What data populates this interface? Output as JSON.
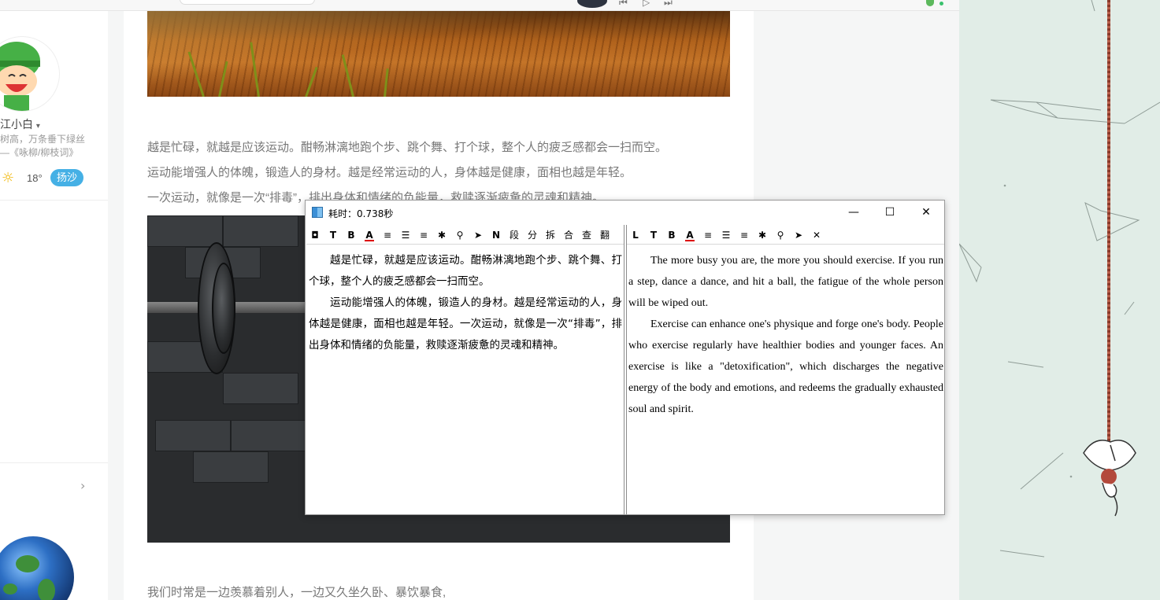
{
  "window": {
    "title": "耗时：0.738秒",
    "minimize": "—",
    "maximize": "☐",
    "close": "✕"
  },
  "source_toolbar": [
    {
      "icon": "stop-icon",
      "glyph": "◘"
    },
    {
      "icon": "text-icon",
      "glyph": "T"
    },
    {
      "icon": "bold-icon",
      "glyph": "B"
    },
    {
      "icon": "font-color-icon",
      "glyph": "A"
    },
    {
      "icon": "align-left-icon",
      "glyph": "≡"
    },
    {
      "icon": "justify-icon",
      "glyph": "☰"
    },
    {
      "icon": "align-right-icon",
      "glyph": "≡"
    },
    {
      "icon": "palette-icon",
      "glyph": "✱"
    },
    {
      "icon": "search-icon",
      "glyph": "⚲"
    },
    {
      "icon": "send-icon",
      "glyph": "➤"
    },
    {
      "icon": "n-icon",
      "glyph": "N"
    },
    {
      "label": "段"
    },
    {
      "label": "分"
    },
    {
      "label": "拆"
    },
    {
      "label": "合"
    },
    {
      "label": "查"
    },
    {
      "label": "翻"
    }
  ],
  "target_toolbar": [
    {
      "icon": "l-icon",
      "glyph": "L"
    },
    {
      "icon": "text-icon",
      "glyph": "T"
    },
    {
      "icon": "bold-icon",
      "glyph": "B"
    },
    {
      "icon": "font-color-icon",
      "glyph": "A"
    },
    {
      "icon": "align-left-icon",
      "glyph": "≡"
    },
    {
      "icon": "justify-icon",
      "glyph": "☰"
    },
    {
      "icon": "align-right-icon",
      "glyph": "≡"
    },
    {
      "icon": "palette-icon",
      "glyph": "✱"
    },
    {
      "icon": "search-icon",
      "glyph": "⚲"
    },
    {
      "icon": "send-icon",
      "glyph": "➤"
    },
    {
      "icon": "close-icon",
      "glyph": "✕"
    }
  ],
  "source_text": [
    "越是忙碌，就越是应该运动。酣畅淋漓地跑个步、跳个舞、打个球，整个人的疲乏感都会一扫而空。",
    "运动能增强人的体魄，锻造人的身材。越是经常运动的人，身体越是健康，面相也越是年轻。一次运动，就像是一次“排毒”，排出身体和情绪的负能量，救赎逐渐疲惫的灵魂和精神。"
  ],
  "target_text": [
    "The more busy you are, the more you should exercise. If you run a step, dance a dance, and hit a ball, the fatigue of the whole person will be wiped out.",
    "Exercise can enhance one's physique and forge one's body. People who exercise regularly have healthier bodies and younger faces. An exercise is like a \"detoxification\", which discharges the negative energy of the body and emotions, and redeems the gradually exhausted soul and spirit."
  ],
  "article": {
    "paragraphs": [
      "越是忙碌，就越是应该运动。酣畅淋漓地跑个步、跳个舞、打个球，整个人的疲乏感都会一扫而空。",
      "运动能增强人的体魄，锻造人的身材。越是经常运动的人，身体越是健康，面相也越是年轻。",
      "一次运动，就像是一次“排毒”，排出身体和情绪的负能量，救赎逐渐疲惫的灵魂和精神。"
    ],
    "last_paragraph": "我们时常是一边羡慕着别人，一边又久坐久卧、暴饮暴食,"
  },
  "sidebar": {
    "name": "江小白",
    "name_caret": "▾",
    "quote_line1": "树高，万条垂下绿丝",
    "quote_line2": "—《咏柳/柳枝词》",
    "temperature": "18°",
    "weather_badge": "扬沙",
    "chevron": "›"
  },
  "player": {
    "prev": "⏮",
    "play": "▷",
    "next": "⏭"
  },
  "colors": {
    "accent_blue": "#45b0e5",
    "deco_bg": "#e1ede7"
  }
}
